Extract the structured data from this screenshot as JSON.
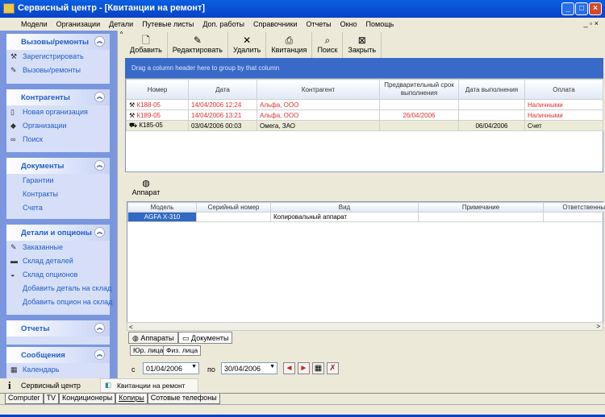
{
  "window": {
    "title": "Сервисный центр  - [Квитанции на ремонт]"
  },
  "menu": [
    "Модели",
    "Организации",
    "Детали",
    "Путевые листы",
    "Доп. работы",
    "Справочники",
    "Отчеты",
    "Окно",
    "Помощь"
  ],
  "sidebar": {
    "groups": [
      {
        "title": "Вызовы/ремонты",
        "items": [
          "Зарегистрировать",
          "Вызовы/ремонты"
        ]
      },
      {
        "title": "Контрагенты",
        "items": [
          "Новая организация",
          "Организации",
          "Поиск"
        ]
      },
      {
        "title": "Документы",
        "items": [
          "Гарантии",
          "Контракты",
          "Счета"
        ]
      },
      {
        "title": "Детали и опционы",
        "items": [
          "Заказанные",
          "Склад деталей",
          "Склад опционов",
          "Добавить деталь на склад",
          "Добавить опцион на склад"
        ]
      },
      {
        "title": "Отчеты",
        "items": []
      },
      {
        "title": "Сообщения",
        "items": [
          "Календарь"
        ]
      }
    ]
  },
  "toolbar": [
    "Добавить",
    "Редактировать",
    "Удалить",
    "Квитанция",
    "Поиск",
    "Закрыть"
  ],
  "group_hint": "Drag a column header here to group by that column",
  "grid1": {
    "columns": [
      "Номер",
      "Дата",
      "Контрагент",
      "Предварительный срок выполнения",
      "Дата выполнения",
      "Оплата"
    ],
    "rows": [
      [
        "К188-05",
        "14/04/2006 12:24",
        "Альфа, ООО",
        "",
        "",
        "Наличными"
      ],
      [
        "К189-05",
        "14/04/2006 13:21",
        "Альфа, ООО",
        "26/04/2006",
        "",
        "Наличными"
      ],
      [
        "К185-05",
        "03/04/2006 00:03",
        "Омега, ЗАО",
        "",
        "06/04/2006",
        "Счет"
      ]
    ]
  },
  "apparat_button": "Аппарат",
  "grid2": {
    "columns": [
      "Модель",
      "Серийный номер",
      "Вид",
      "Примечание",
      "Ответственный"
    ],
    "rows": [
      [
        "AGFA X-310",
        "",
        "Копировальный аппарат",
        "",
        ""
      ]
    ]
  },
  "detail_tabs": [
    "Аппараты",
    "Документы"
  ],
  "sub_tabs": [
    "Юр. лица",
    "Физ. лица"
  ],
  "filter": {
    "from_label": "с",
    "from": "01/04/2006",
    "to_label": "по",
    "to": "30/04/2006"
  },
  "taskbar": [
    "Сервисный центр",
    "Квитанции на ремонт"
  ],
  "bottom_tabs": [
    "Computer",
    "TV",
    "Кондиционеры",
    "Копиры",
    "Сотовые телефоны"
  ]
}
